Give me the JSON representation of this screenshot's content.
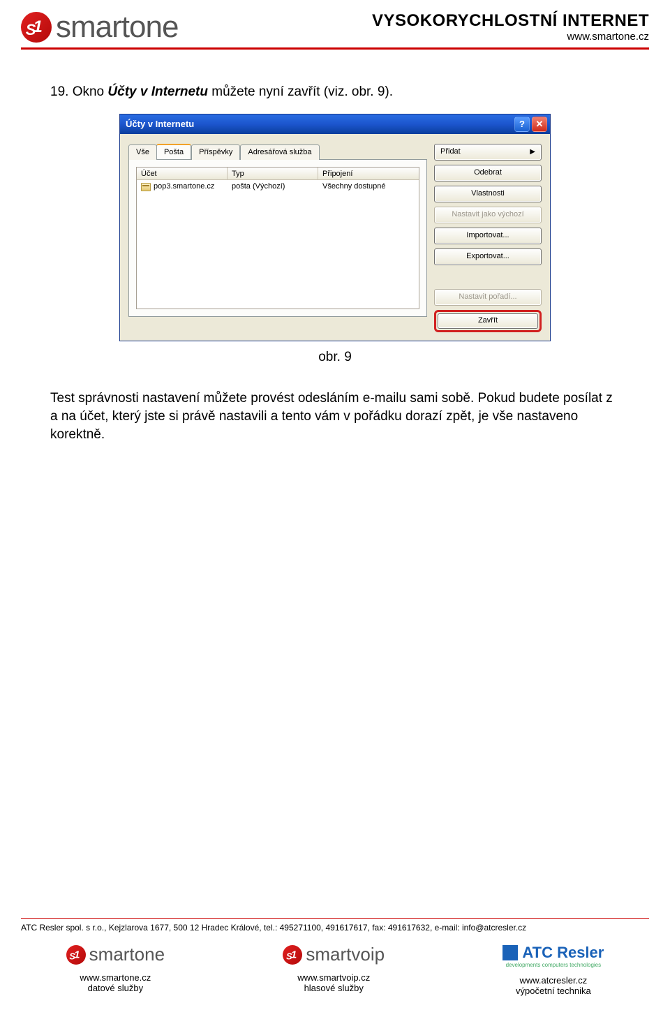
{
  "header": {
    "brand": "smartone",
    "title": "VYSOKORYCHLOSTNÍ INTERNET",
    "url": "www.smartone.cz"
  },
  "step": {
    "number": "19.",
    "pre": "Okno ",
    "bold": "Účty v Internetu",
    "post": " můžete nyní zavřít (viz. obr. 9)."
  },
  "dialog": {
    "title": "Účty v Internetu",
    "tabs": [
      "Vše",
      "Pošta",
      "Příspěvky",
      "Adresářová služba"
    ],
    "active_tab": 1,
    "list": {
      "headers": [
        "Účet",
        "Typ",
        "Připojení"
      ],
      "row": {
        "account": "pop3.smartone.cz",
        "type": "pošta (Výchozí)",
        "connection": "Všechny dostupné"
      }
    },
    "buttons": {
      "add": "Přidat",
      "remove": "Odebrat",
      "properties": "Vlastnosti",
      "set_default": "Nastavit jako výchozí",
      "import": "Importovat...",
      "export": "Exportovat...",
      "set_order": "Nastavit pořadí...",
      "close": "Zavřít"
    }
  },
  "caption": "obr. 9",
  "post_text": "Test správnosti nastavení můžete provést odesláním e-mailu sami sobě. Pokud budete posílat z a na účet, který jste si právě nastavili a tento vám v pořádku dorazí zpět, je vše nastaveno korektně.",
  "footer": {
    "company_line": "ATC Resler spol. s r.o., Kejzlarova 1677, 500 12  Hradec Králové, tel.: 495271100, 491617617, fax: 491617632, e-mail: info@atcresler.cz",
    "cols": [
      {
        "brand": "smartone",
        "url": "www.smartone.cz",
        "desc": "datové služby"
      },
      {
        "brand": "smartvoip",
        "url": "www.smartvoip.cz",
        "desc": "hlasové služby"
      },
      {
        "brand": "ATC Resler",
        "sub": "developments computers technologies",
        "url": "www.atcresler.cz",
        "desc": "výpočetní technika"
      }
    ]
  }
}
